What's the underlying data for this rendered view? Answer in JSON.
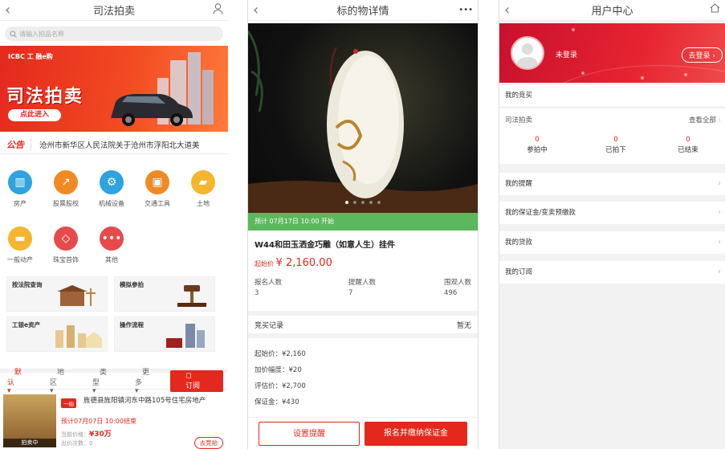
{
  "p1": {
    "title": "司法拍卖",
    "search_placeholder": "请输入拍品名称",
    "banner_brand": "ICBC 工 融e购",
    "banner_title": "司法拍卖",
    "banner_enter": "点此进入",
    "notice_tag": "公告",
    "notice_text": "沧州市新华区人民法院关于沧州市浮阳北大道美",
    "categories": [
      {
        "label": "房产",
        "color": "#2fa2e0",
        "icon": "building-icon"
      },
      {
        "label": "股票股权",
        "color": "#f08a24",
        "icon": "chart-icon"
      },
      {
        "label": "机械设备",
        "color": "#2fa2e0",
        "icon": "gear-icon"
      },
      {
        "label": "交通工具",
        "color": "#f08a24",
        "icon": "train-icon"
      },
      {
        "label": "土地",
        "color": "#f5b52e",
        "icon": "land-icon"
      },
      {
        "label": "一般动产",
        "color": "#f5b52e",
        "icon": "car-icon"
      },
      {
        "label": "珠宝首饰",
        "color": "#e64a4a",
        "icon": "diamond-icon"
      },
      {
        "label": "其他",
        "color": "#e64a4a",
        "icon": "more-icon"
      }
    ],
    "tiles": [
      "按法院查询",
      "模拟参拍",
      "工银e资产",
      "操作流程"
    ],
    "filters": [
      "默认",
      "地区",
      "类型",
      "更多"
    ],
    "subscribe": "订阅",
    "item": {
      "thumb_label": "拍卖中",
      "tag": "一拍",
      "title": "旌德县旌阳镇河东中路105号住宅房地产",
      "date": "预计07月07日 10:00结束",
      "price_label": "当前价格：",
      "price": "¥30万",
      "count_label": "出价次数：",
      "count": "0",
      "go": "去竞拍"
    }
  },
  "p2": {
    "title": "标的物详情",
    "more": "•••",
    "start_notice": "预计 07月17日 10:00  开始",
    "name": "W44和田玉洒金巧雕（如意人生）挂件",
    "price_label": "起始价",
    "price": "¥ 2,160.00",
    "stats": [
      {
        "label": "报名人数",
        "value": "3"
      },
      {
        "label": "提醒人数",
        "value": "7"
      },
      {
        "label": "围观人数",
        "value": "496"
      }
    ],
    "record_label": "竞买记录",
    "record_value": "暂无",
    "info": [
      "起始价：¥2,160",
      "加价幅度：¥20",
      "评估价：¥2,700",
      "保证金：¥430"
    ],
    "btn_remind": "设置提醒",
    "btn_signup": "报名并缴纳保证金"
  },
  "p3": {
    "title": "用户中心",
    "user": "未登录",
    "login": "去登录",
    "my_bids": "我的竞买",
    "auction": "司法拍卖",
    "view_all": "查看全部",
    "counts": [
      {
        "label": "参拍中",
        "value": "0"
      },
      {
        "label": "已拍下",
        "value": "0"
      },
      {
        "label": "已结束",
        "value": "0"
      }
    ],
    "menu": [
      "我的提醒",
      "我的保证金/变卖预缴款",
      "我的贷款",
      "我的订阅"
    ]
  }
}
